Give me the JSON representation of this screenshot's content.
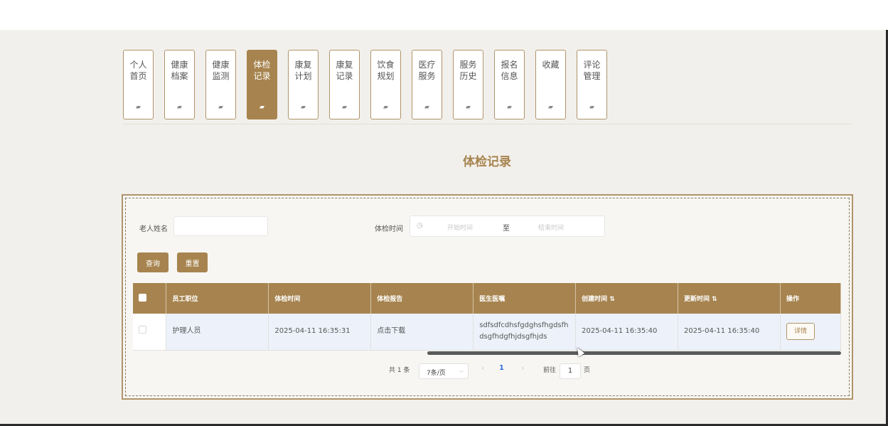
{
  "nav": {
    "items": [
      {
        "label": "个人首页",
        "active": false
      },
      {
        "label": "健康档案",
        "active": false
      },
      {
        "label": "健康监测",
        "active": false
      },
      {
        "label": "体检记录",
        "active": true
      },
      {
        "label": "康复计划",
        "active": false
      },
      {
        "label": "康复记录",
        "active": false
      },
      {
        "label": "饮食规划",
        "active": false
      },
      {
        "label": "医疗服务",
        "active": false
      },
      {
        "label": "服务历史",
        "active": false
      },
      {
        "label": "报名信息",
        "active": false
      },
      {
        "label": "收藏",
        "active": false
      },
      {
        "label": "评论管理",
        "active": false
      }
    ],
    "icon": "home-icon"
  },
  "page_title": "体检记录",
  "filters": {
    "name_label": "老人姓名",
    "name_value": "",
    "time_label": "体检时间",
    "start_placeholder": "开始时间",
    "range_sep": "至",
    "end_placeholder": "结束时间",
    "search_button": "查询",
    "reset_button": "重置"
  },
  "table": {
    "columns": [
      "员工职位",
      "体检时间",
      "体检报告",
      "医生医嘱",
      "创建时间 ⇅",
      "更新时间 ⇅",
      "操作"
    ],
    "rows": [
      {
        "position": "护理人员",
        "exam_time": "2025-04-11 16:35:31",
        "report": "点击下载",
        "advice": "sdfsdfcdhsfgdghsfhgdsfh dsgfhdgfhjdsgfhjds",
        "created": "2025-04-11 16:35:40",
        "updated": "2025-04-11 16:35:40",
        "action": "详情"
      }
    ]
  },
  "pagination": {
    "total_text": "共 1 条",
    "page_size": "7条/页",
    "current_page": "1",
    "goto_label": "前往",
    "goto_value": "1",
    "page_unit": "页"
  },
  "colors": {
    "accent": "#a7844f",
    "row_bg": "#edf2fa"
  }
}
